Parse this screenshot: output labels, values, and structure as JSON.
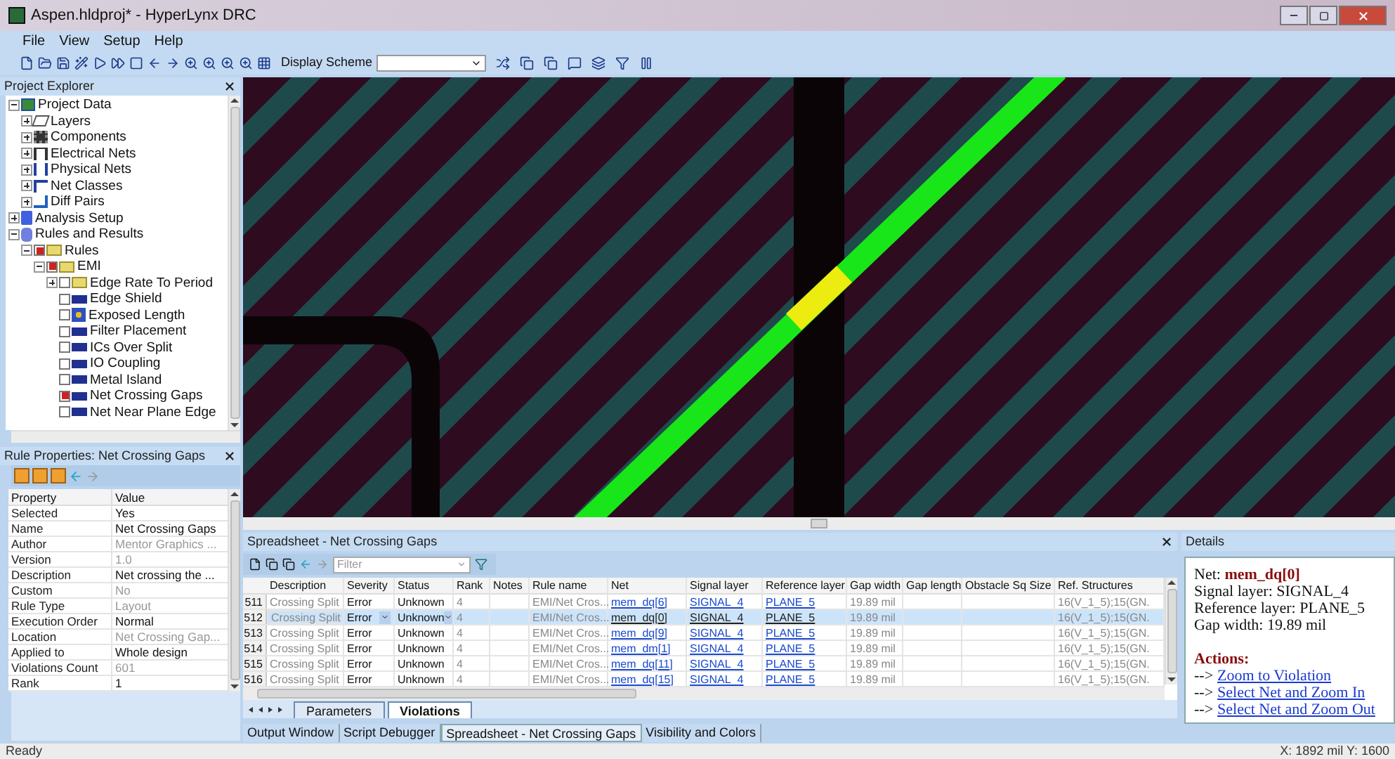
{
  "window": {
    "title": "Aspen.hldproj* - HyperLynx DRC"
  },
  "menu": [
    "File",
    "View",
    "Setup",
    "Help"
  ],
  "toolbar": {
    "display_scheme_label": "Display Scheme"
  },
  "project_explorer": {
    "title": "Project Explorer",
    "tree": [
      {
        "label": "Project Data",
        "kind": "project",
        "expanded": true,
        "children": [
          {
            "label": "Layers",
            "kind": "layers",
            "expanded": false
          },
          {
            "label": "Components",
            "kind": "components",
            "expanded": false
          },
          {
            "label": "Electrical Nets",
            "kind": "nets",
            "expanded": false
          },
          {
            "label": "Physical Nets",
            "kind": "physical",
            "expanded": false
          },
          {
            "label": "Net Classes",
            "kind": "classes",
            "expanded": false
          },
          {
            "label": "Diff Pairs",
            "kind": "pairs",
            "expanded": false
          }
        ]
      },
      {
        "label": "Analysis Setup",
        "kind": "setup",
        "expanded": false
      },
      {
        "label": "Rules and Results",
        "kind": "results",
        "expanded": true,
        "children": [
          {
            "label": "Rules",
            "kind": "folder",
            "expanded": true,
            "checked": true,
            "children": [
              {
                "label": "EMI",
                "kind": "folder",
                "expanded": true,
                "checked": true,
                "children": [
                  {
                    "label": "Edge Rate To Period",
                    "kind": "folder",
                    "expanded": false,
                    "checked": false
                  },
                  {
                    "label": "Edge Shield",
                    "kind": "drc",
                    "checked": false
                  },
                  {
                    "label": "Exposed Length",
                    "kind": "multi",
                    "checked": false
                  },
                  {
                    "label": "Filter Placement",
                    "kind": "drc",
                    "checked": false
                  },
                  {
                    "label": "ICs Over Split",
                    "kind": "drc",
                    "checked": false
                  },
                  {
                    "label": "IO Coupling",
                    "kind": "drc",
                    "checked": false
                  },
                  {
                    "label": "Metal Island",
                    "kind": "drc",
                    "checked": false
                  },
                  {
                    "label": "Net Crossing Gaps",
                    "kind": "drc",
                    "checked": true
                  },
                  {
                    "label": "Net Near Plane Edge",
                    "kind": "drc",
                    "checked": false
                  }
                ]
              }
            ]
          }
        ]
      }
    ]
  },
  "rule_properties": {
    "title": "Rule Properties: Net Crossing Gaps",
    "columns": [
      "Property",
      "Value"
    ],
    "rows": [
      {
        "property": "Selected",
        "value": "Yes",
        "muted": false
      },
      {
        "property": "Name",
        "value": "Net Crossing Gaps",
        "muted": false
      },
      {
        "property": "Author",
        "value": "Mentor Graphics ...",
        "muted": true
      },
      {
        "property": "Version",
        "value": "1.0",
        "muted": true
      },
      {
        "property": "Description",
        "value": "Net crossing the ...",
        "muted": false
      },
      {
        "property": "Custom",
        "value": "No",
        "muted": true
      },
      {
        "property": "Rule Type",
        "value": "Layout",
        "muted": true
      },
      {
        "property": "Execution Order",
        "value": "Normal",
        "muted": false
      },
      {
        "property": "Location",
        "value": "Net Crossing Gap...",
        "muted": true
      },
      {
        "property": "Applied to",
        "value": "Whole design",
        "muted": false
      },
      {
        "property": "Violations Count",
        "value": "601",
        "muted": true
      },
      {
        "property": "Rank",
        "value": "1",
        "muted": false
      }
    ]
  },
  "spreadsheet": {
    "title": "Spreadsheet - Net Crossing Gaps",
    "filter_placeholder": "Filter",
    "columns": [
      "Description",
      "Severity",
      "Status",
      "Rank",
      "Notes",
      "Rule name",
      "Net",
      "Signal layer",
      "Reference layer",
      "Gap width",
      "Gap length",
      "Obstacle Sq Size",
      "Ref. Structures"
    ],
    "rows": [
      {
        "number": "511",
        "description": "Crossing Split",
        "severity": "Error",
        "status": "Unknown",
        "rank": "4",
        "rule_name": "EMI/Net Cros...",
        "net": "mem_dq[6]",
        "signal_layer": "SIGNAL_4",
        "reference_layer": "PLANE_5",
        "gap_width": "19.89 mil",
        "ref_structures": "16(V_1_5);15(GN.",
        "selected": false
      },
      {
        "number": "512",
        "description": "Crossing Split",
        "severity": "Error",
        "status": "Unknown",
        "rank": "4",
        "rule_name": "EMI/Net Cros...",
        "net": "mem_dq[0]",
        "signal_layer": "SIGNAL_4",
        "reference_layer": "PLANE_5",
        "gap_width": "19.89 mil",
        "ref_structures": "16(V_1_5);15(GN.",
        "selected": true
      },
      {
        "number": "513",
        "description": "Crossing Split",
        "severity": "Error",
        "status": "Unknown",
        "rank": "4",
        "rule_name": "EMI/Net Cros...",
        "net": "mem_dq[9]",
        "signal_layer": "SIGNAL_4",
        "reference_layer": "PLANE_5",
        "gap_width": "19.89 mil",
        "ref_structures": "16(V_1_5);15(GN.",
        "selected": false
      },
      {
        "number": "514",
        "description": "Crossing Split",
        "severity": "Error",
        "status": "Unknown",
        "rank": "4",
        "rule_name": "EMI/Net Cros...",
        "net": "mem_dm[1]",
        "signal_layer": "SIGNAL_4",
        "reference_layer": "PLANE_5",
        "gap_width": "19.89 mil",
        "ref_structures": "16(V_1_5);15(GN.",
        "selected": false
      },
      {
        "number": "515",
        "description": "Crossing Split",
        "severity": "Error",
        "status": "Unknown",
        "rank": "4",
        "rule_name": "EMI/Net Cros...",
        "net": "mem_dq[11]",
        "signal_layer": "SIGNAL_4",
        "reference_layer": "PLANE_5",
        "gap_width": "19.89 mil",
        "ref_structures": "16(V_1_5);15(GN.",
        "selected": false
      },
      {
        "number": "516",
        "description": "Crossing Split",
        "severity": "Error",
        "status": "Unknown",
        "rank": "4",
        "rule_name": "EMI/Net Cros...",
        "net": "mem_dq[15]",
        "signal_layer": "SIGNAL_4",
        "reference_layer": "PLANE_5",
        "gap_width": "19.89 mil",
        "ref_structures": "16(V_1_5);15(GN.",
        "selected": false
      }
    ],
    "sheet_tabs": [
      {
        "label": "Parameters",
        "selected": false
      },
      {
        "label": "Violations",
        "selected": true
      }
    ]
  },
  "bottom_tabs": [
    {
      "label": "Output Window",
      "selected": false
    },
    {
      "label": "Script Debugger",
      "selected": false
    },
    {
      "label": "Spreadsheet - Net Crossing Gaps",
      "selected": true
    },
    {
      "label": "Visibility and Colors",
      "selected": false
    }
  ],
  "details": {
    "title": "Details",
    "net_label": "Net:",
    "net_value": "mem_dq[0]",
    "lines": [
      "Signal layer: SIGNAL_4",
      "Reference layer: PLANE_5",
      "Gap width: 19.89 mil"
    ],
    "actions_heading": "Actions:",
    "actions": [
      {
        "prefix": "-->",
        "link": "Zoom to Violation"
      },
      {
        "prefix": "-->",
        "link": "Select Net and Zoom In"
      },
      {
        "prefix": "-->",
        "link": "Select Net and Zoom Out"
      }
    ]
  },
  "status_bar": {
    "message": "Ready",
    "coordinates": "X: 1892 mil  Y: 1600"
  }
}
